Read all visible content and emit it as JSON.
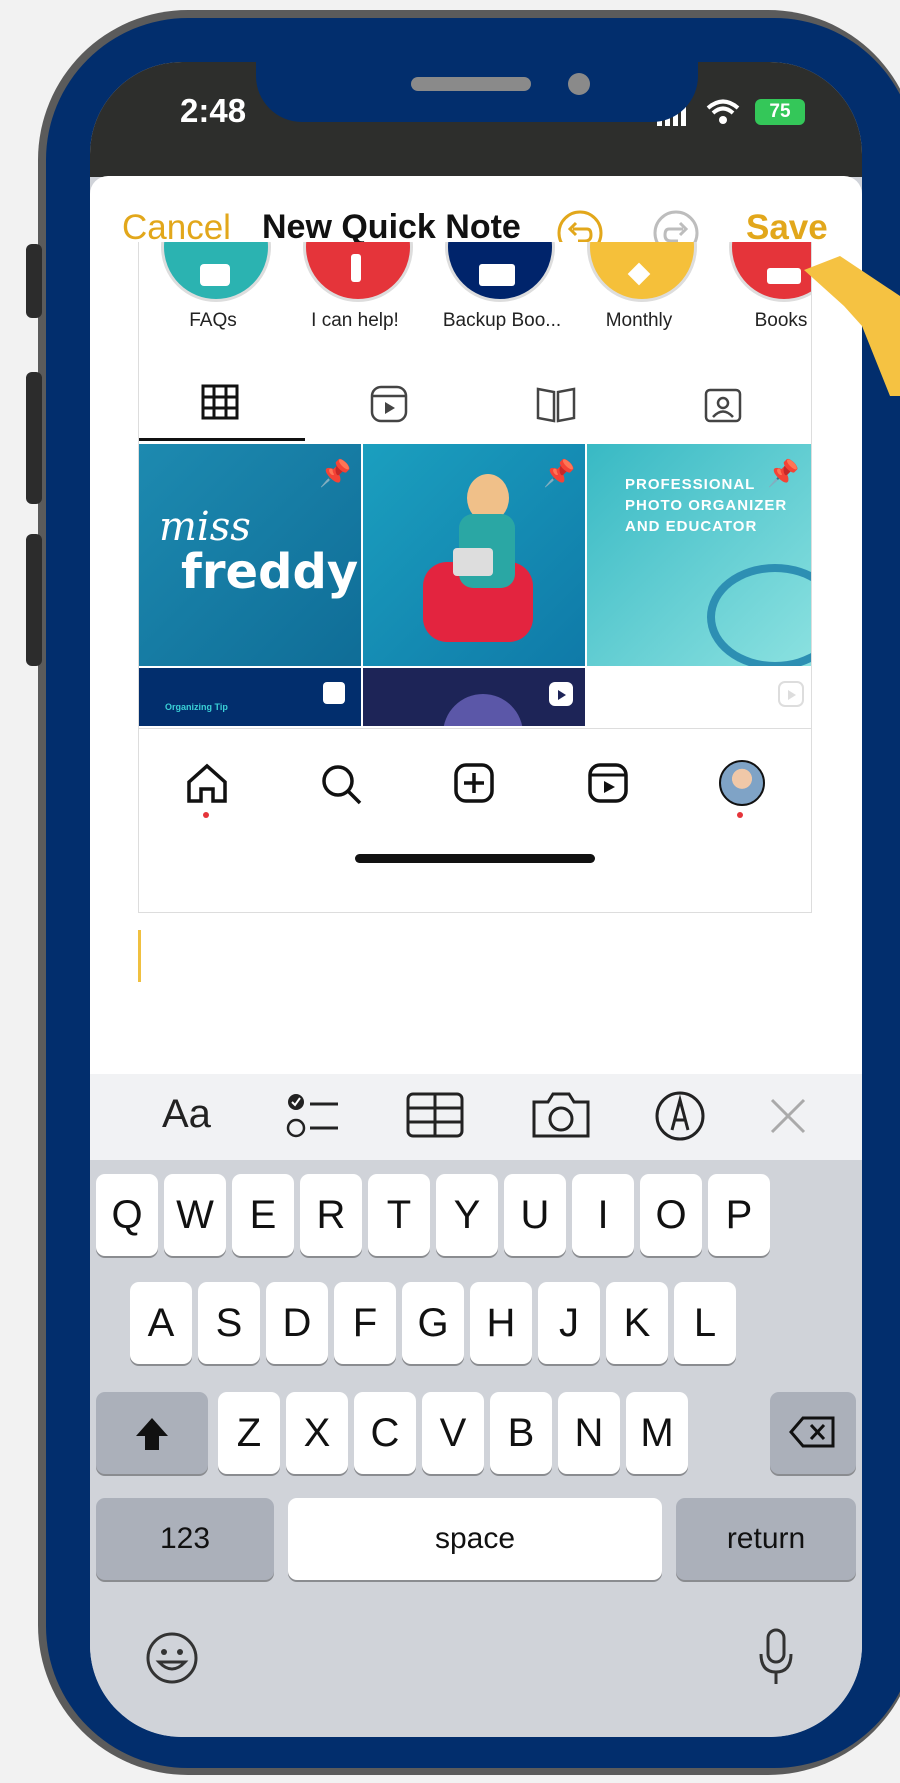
{
  "status": {
    "time": "2:48",
    "battery": "75"
  },
  "header": {
    "cancel_label": "Cancel",
    "title": "New Quick Note",
    "save_label": "Save"
  },
  "highlights": [
    {
      "label": "FAQs",
      "color": "#2bb3b1"
    },
    {
      "label": "I can help!",
      "color": "#e5343a"
    },
    {
      "label": "Backup Boo...",
      "color": "#00246b"
    },
    {
      "label": "Monthly",
      "color": "#f5c03a"
    },
    {
      "label": "Books",
      "color": "#e5343a"
    }
  ],
  "tiles": {
    "logo_line1": "miss",
    "logo_line2": "freddy",
    "pro_text": "PROFESSIONAL PHOTO ORGANIZER AND EDUCATOR",
    "tip_text": "Organizing Tip"
  },
  "keyboard": {
    "row1": [
      "Q",
      "W",
      "E",
      "R",
      "T",
      "Y",
      "U",
      "I",
      "O",
      "P"
    ],
    "row2": [
      "A",
      "S",
      "D",
      "F",
      "G",
      "H",
      "J",
      "K",
      "L"
    ],
    "row3": [
      "Z",
      "X",
      "C",
      "V",
      "B",
      "N",
      "M"
    ],
    "numbers_label": "123",
    "space_label": "space",
    "return_label": "return"
  },
  "toolbar": {
    "format_label": "Aa"
  },
  "colors": {
    "accent": "#e2a71b",
    "frame": "#022e6d",
    "arrow": "#f5c242"
  }
}
